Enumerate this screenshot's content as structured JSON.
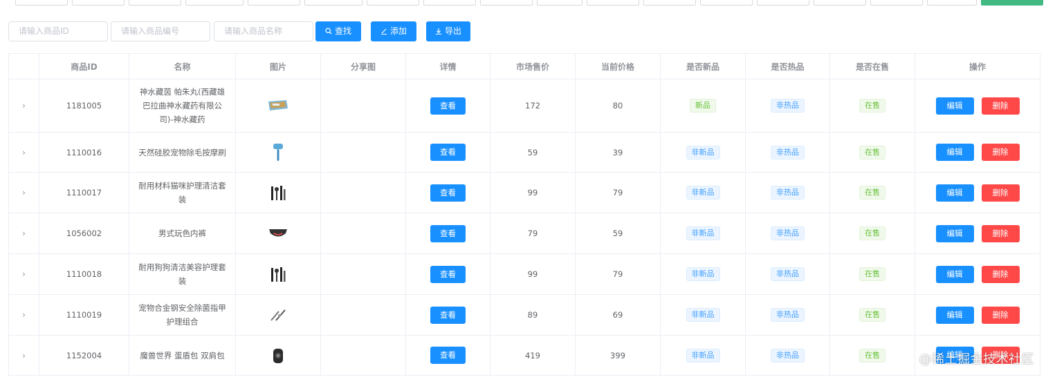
{
  "toolbar": {
    "id_placeholder": "请输入商品ID",
    "code_placeholder": "请输入商品编号",
    "name_placeholder": "请输入商品名称",
    "search_label": "查找",
    "add_label": "添加",
    "export_label": "导出"
  },
  "table": {
    "headers": [
      "",
      "商品ID",
      "名称",
      "图片",
      "分享图",
      "详情",
      "市场售价",
      "当前价格",
      "是否新品",
      "是否热品",
      "是否在售",
      "操作"
    ],
    "view_label": "查看",
    "edit_label": "编辑",
    "delete_label": "删除",
    "rows": [
      {
        "id": "1181005",
        "name": "神水藏茵 帕朱丸(西藏雄巴拉曲神水藏药有限公司)-神水藏药",
        "market_price": "172",
        "price": "80",
        "is_new": "新品",
        "is_hot": "非热品",
        "on_sale": "在售",
        "image_icon": "medicine-box-thumb"
      },
      {
        "id": "1110016",
        "name": "天然硅胶宠物除毛按摩刷",
        "market_price": "59",
        "price": "39",
        "is_new": "非新品",
        "is_hot": "非热品",
        "on_sale": "在售",
        "image_icon": "pet-brush-thumb"
      },
      {
        "id": "1110017",
        "name": "耐用材料猫咪护理清洁套装",
        "market_price": "99",
        "price": "79",
        "is_new": "非新品",
        "is_hot": "非热品",
        "on_sale": "在售",
        "image_icon": "grooming-set-thumb"
      },
      {
        "id": "1056002",
        "name": "男式玩色内裤",
        "market_price": "79",
        "price": "59",
        "is_new": "非新品",
        "is_hot": "非热品",
        "on_sale": "在售",
        "image_icon": "underwear-thumb"
      },
      {
        "id": "1110018",
        "name": "耐用狗狗清洁美容护理套装",
        "market_price": "99",
        "price": "79",
        "is_new": "非新品",
        "is_hot": "非热品",
        "on_sale": "在售",
        "image_icon": "grooming-set-thumb"
      },
      {
        "id": "1110019",
        "name": "宠物合金钢安全除菌指甲护理组合",
        "market_price": "89",
        "price": "69",
        "is_new": "非新品",
        "is_hot": "非热品",
        "on_sale": "在售",
        "image_icon": "nail-clipper-thumb"
      },
      {
        "id": "1152004",
        "name": "魔兽世界 蛋盾包 双肩包",
        "market_price": "419",
        "price": "399",
        "is_new": "非新品",
        "is_hot": "非热品",
        "on_sale": "在售",
        "image_icon": "backpack-thumb"
      }
    ]
  },
  "colors": {
    "primary": "#1890ff",
    "danger": "#ff4949",
    "success": "#67c23a",
    "info": "#409eff",
    "active_tag": "#42b983"
  },
  "watermark": "@稀土掘金技术社区"
}
